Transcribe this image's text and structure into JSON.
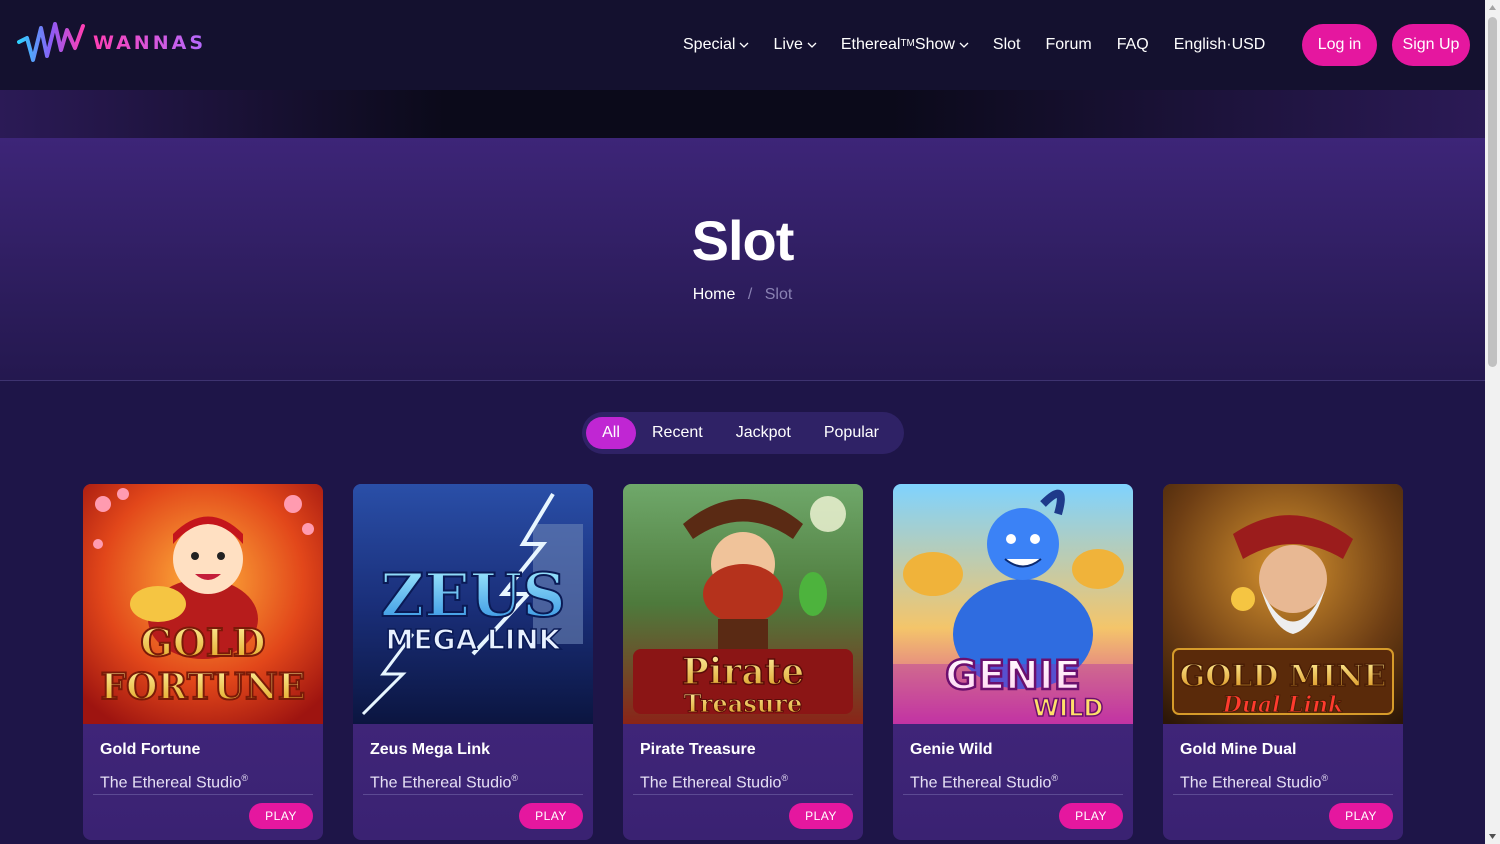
{
  "brand": {
    "name": "WANNAS"
  },
  "nav": {
    "special": "Special",
    "live": "Live",
    "show_prefix": "Ethereal",
    "show_tm": "TM",
    "show_suffix": "Show",
    "slot": "Slot",
    "forum": "Forum",
    "faq": "FAQ",
    "language": "English",
    "currency_sep": "·",
    "currency": "USD"
  },
  "auth": {
    "login": "Log in",
    "signup": "Sign Up"
  },
  "hero": {
    "title": "Slot",
    "breadcrumb": {
      "home": "Home",
      "separator": "/",
      "current": "Slot"
    }
  },
  "filters": {
    "tabs": [
      "All",
      "Recent",
      "Jackpot",
      "Popular"
    ],
    "active": "All"
  },
  "games": [
    {
      "title": "Gold Fortune",
      "art_line1": "GOLD",
      "art_line2": "FORTUNE",
      "studio": "The Ethereal Studio",
      "reg": "®",
      "play": "PLAY"
    },
    {
      "title": "Zeus Mega Link",
      "art_line1": "ZEUS",
      "art_line2": "MEGA LINK",
      "studio": "The Ethereal Studio",
      "reg": "®",
      "play": "PLAY"
    },
    {
      "title": "Pirate Treasure",
      "art_line1": "Pirate",
      "art_line2": "Treasure",
      "studio": "The Ethereal Studio",
      "reg": "®",
      "play": "PLAY"
    },
    {
      "title": "Genie Wild",
      "art_line1": "GENIE",
      "art_line2": "WILD",
      "studio": "The Ethereal Studio",
      "reg": "®",
      "play": "PLAY"
    },
    {
      "title": "Gold Mine Dual",
      "art_line1": "GOLD MINE",
      "art_line2": "Dual Link",
      "studio": "The Ethereal Studio",
      "reg": "®",
      "play": "PLAY"
    }
  ],
  "colors": {
    "accent": "#e5179f",
    "header_bg": "#14112f",
    "page_bg": "#1e1548",
    "tab_active": "#c026d3"
  }
}
